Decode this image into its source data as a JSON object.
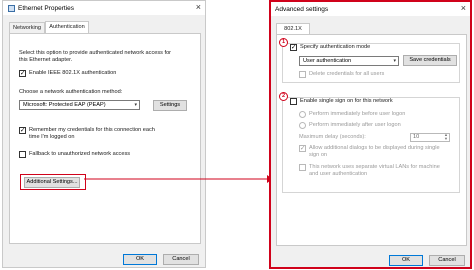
{
  "left_window": {
    "title": "Ethernet Properties",
    "tabs": [
      "Networking",
      "Authentication"
    ],
    "description": [
      "Select this option to provide authenticated network access for",
      "this Ethernet adapter."
    ],
    "enable_8021x": "Enable IEEE 802.1X authentication",
    "method_label": "Choose a network authentication method:",
    "method_value": "Microsoft: Protected EAP (PEAP)",
    "settings_button": "Settings",
    "remember_credentials": [
      "Remember my credentials for this connection each",
      "time I'm logged on"
    ],
    "fallback": "Fallback to unauthorized network access",
    "additional_settings_button": "Additional Settings...",
    "ok_button": "OK",
    "cancel_button": "Cancel"
  },
  "right_window": {
    "title": "Advanced settings",
    "tab": "802.1X settings",
    "marker_1": "1",
    "marker_2": "2",
    "specify_auth_mode": "Specify authentication mode",
    "auth_mode_value": "User authentication",
    "save_credentials_button": "Save credentials",
    "delete_credentials": "Delete credentials for all users",
    "enable_sso": "Enable single sign on for this network",
    "perform_before": "Perform immediately before user logon",
    "perform_after": "Perform immediately after user logon",
    "max_delay_label": "Maximum delay (seconds):",
    "max_delay_value": "10",
    "allow_dialogs": [
      "Allow additional dialogs to be displayed during single",
      "sign on"
    ],
    "separate_vlans": [
      "This network uses separate virtual LANs for machine",
      "and user authentication"
    ],
    "ok_button": "OK",
    "cancel_button": "Cancel"
  },
  "colors": {
    "highlight": "#d0021b",
    "dialog_bg": "#f0f0f0",
    "primary_border": "#0078d7"
  }
}
